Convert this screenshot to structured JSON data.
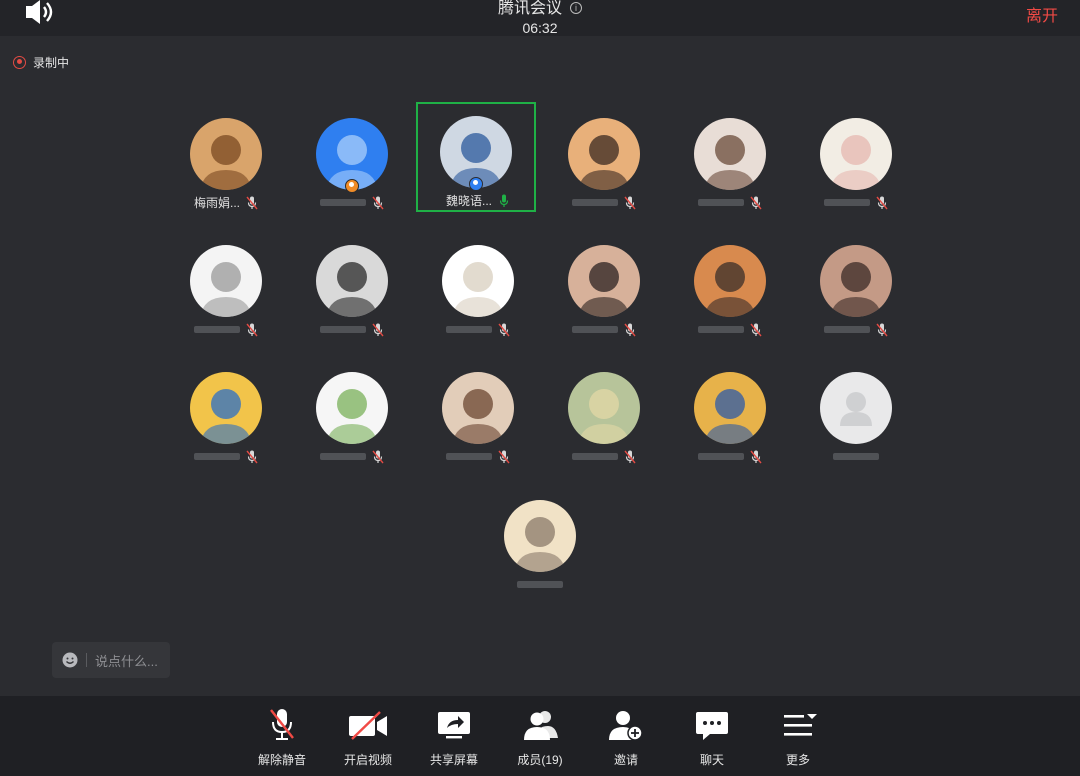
{
  "header": {
    "title": "腾讯会议",
    "timer": "06:32",
    "leave_label": "离开"
  },
  "recording": {
    "label": "录制中",
    "color": "#e34b44"
  },
  "participants": [
    {
      "name": "梅雨娟...",
      "mic": "muted"
    },
    {
      "name": "",
      "mic": "muted",
      "badge": "host-orange"
    },
    {
      "name": "魏晓语...",
      "mic": "active",
      "badge": "host-blue",
      "speaking": true
    },
    {
      "name": "",
      "mic": "muted"
    },
    {
      "name": "",
      "mic": "muted"
    },
    {
      "name": "",
      "mic": "muted"
    },
    {
      "name": "",
      "mic": "muted"
    },
    {
      "name": "",
      "mic": "muted"
    },
    {
      "name": "",
      "mic": "muted"
    },
    {
      "name": "",
      "mic": "muted"
    },
    {
      "name": "",
      "mic": "muted"
    },
    {
      "name": "",
      "mic": "muted"
    },
    {
      "name": "",
      "mic": "muted"
    },
    {
      "name": "",
      "mic": "muted"
    },
    {
      "name": "",
      "mic": "muted"
    },
    {
      "name": "",
      "mic": "muted"
    },
    {
      "name": "",
      "mic": "muted"
    },
    {
      "name": "",
      "mic": "none"
    },
    {
      "name": "",
      "mic": "none"
    }
  ],
  "chat": {
    "placeholder": "说点什么..."
  },
  "toolbar": {
    "unmute_label": "解除静音",
    "video_label": "开启视频",
    "share_label": "共享屏幕",
    "members_label": "成员(19)",
    "invite_label": "邀请",
    "chat_label": "聊天",
    "more_label": "更多"
  },
  "colors": {
    "background": "#2b2c30",
    "toolbar": "#1f2024",
    "accent_green": "#1fb146",
    "leave_red": "#f14a45",
    "muted_red": "#e34b44"
  },
  "icons": {
    "speaker": "speaker-icon",
    "info": "info-icon",
    "mic_muted": "mic-muted-icon",
    "mic_active": "mic-active-icon",
    "smile": "smile-icon"
  }
}
